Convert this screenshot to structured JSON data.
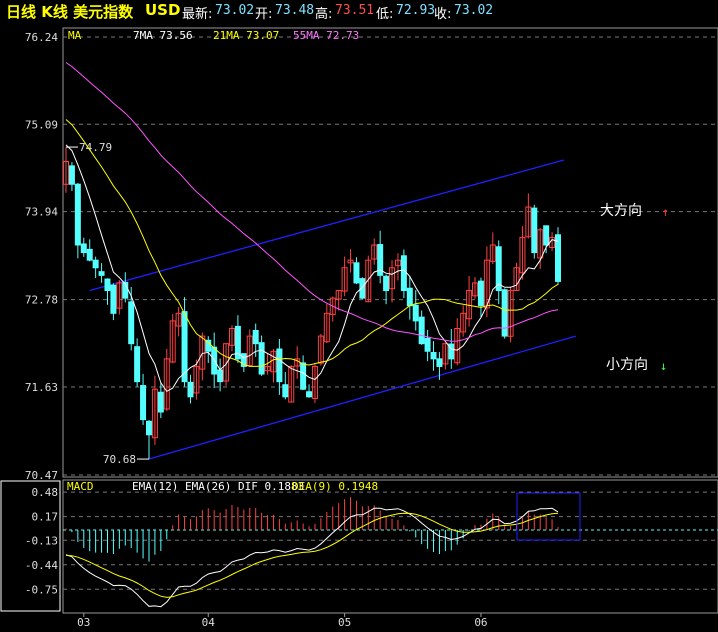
{
  "header": {
    "title": "日线 K线 美元指数",
    "symbol": "USD",
    "latest_label": "最新:",
    "latest": "73.02",
    "open_label": "开:",
    "open": "73.48",
    "high_label": "高:",
    "high": "73.51",
    "low_label": "低:",
    "low": "72.93",
    "close_label": "收:",
    "close": "73.02"
  },
  "legend": {
    "ma": "MA",
    "ma7": "7MA 73.56",
    "ma21": "21MA 73.07",
    "ma55": "55MA 72.73",
    "macd": "MACD",
    "ema": "EMA(12) EMA(26) DIF 0.1883",
    "dea": "DEA(9) 0.1948"
  },
  "colors": {
    "up": "#ff4040",
    "down": "#54ffff",
    "ma7": "#ffffff",
    "ma21": "#ffff00",
    "ma55": "#ff55ff",
    "channel": "#2020ff",
    "dif": "#ffffff",
    "dea": "#ffff00"
  },
  "chart_data": {
    "type": "candlestick",
    "title": "日线 K线 美元指数 USD",
    "y_ticks": [
      "76.24",
      "75.09",
      "73.94",
      "72.78",
      "71.63",
      "70.47"
    ],
    "ylim": [
      70.47,
      76.24
    ],
    "x_ticks": [
      {
        "label": "03",
        "index": 3
      },
      {
        "label": "04",
        "index": 24
      },
      {
        "label": "05",
        "index": 47
      },
      {
        "label": "06",
        "index": 70
      }
    ],
    "closes": [
      74.6,
      74.3,
      73.5,
      73.4,
      73.3,
      73.2,
      73.1,
      72.9,
      72.6,
      73.0,
      72.8,
      72.2,
      71.7,
      71.2,
      71.0,
      71.6,
      71.3,
      72.0,
      72.5,
      72.6,
      71.7,
      71.5,
      71.9,
      72.3,
      72.1,
      71.8,
      71.7,
      72.2,
      72.4,
      72.0,
      71.9,
      72.3,
      72.2,
      71.8,
      71.9,
      72.1,
      71.7,
      71.5,
      71.9,
      72.0,
      71.6,
      71.5,
      71.9,
      72.3,
      72.6,
      72.8,
      72.9,
      73.2,
      73.3,
      73.0,
      72.8,
      73.3,
      73.5,
      73.1,
      72.9,
      73.2,
      73.3,
      72.9,
      72.7,
      72.5,
      72.2,
      72.1,
      72.0,
      71.9,
      72.2,
      72.0,
      72.4,
      72.6,
      72.9,
      73.0,
      72.7,
      73.3,
      73.5,
      72.9,
      72.3,
      72.9,
      73.2,
      73.6,
      74.0,
      73.4,
      73.7,
      73.5,
      73.6,
      73.02
    ],
    "annotations": [
      {
        "text": "74.79",
        "index": 0,
        "price": 74.79
      },
      {
        "text": "70.68",
        "index": 14,
        "price": 70.68
      },
      {
        "text": "大方向",
        "arrow": "up"
      },
      {
        "text": "小方向",
        "arrow": "down"
      }
    ],
    "channel_upper": [
      [
        4,
        72.9
      ],
      [
        84,
        74.62
      ]
    ],
    "channel_lower": [
      [
        14,
        70.68
      ],
      [
        86,
        72.3
      ]
    ],
    "macd_ticks": [
      "0.48",
      "0.17",
      "-0.13",
      "-0.44",
      "-0.75"
    ],
    "macd_ylim": [
      -1.0,
      0.6
    ]
  }
}
